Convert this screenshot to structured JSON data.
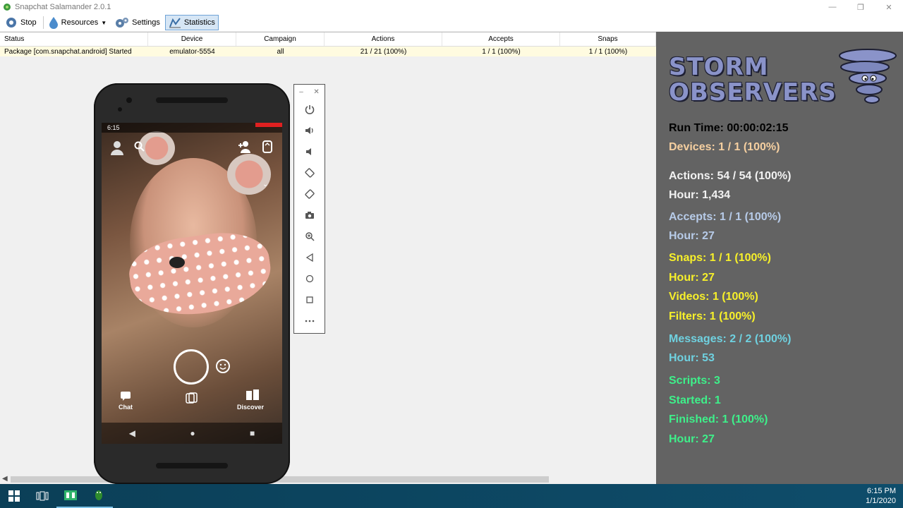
{
  "window": {
    "title": "Snapchat Salamander 2.0.1"
  },
  "toolbar": {
    "stop_label": "Stop",
    "resources_label": "Resources",
    "settings_label": "Settings",
    "statistics_label": "Statistics"
  },
  "grid": {
    "headers": [
      "Status",
      "Device",
      "Campaign",
      "Actions",
      "Accepts",
      "Snaps"
    ],
    "rows": [
      {
        "status": "Package [com.snapchat.android] Started",
        "device": "emulator-5554",
        "campaign": "all",
        "actions": "21 / 21 (100%)",
        "accepts": "1 / 1 (100%)",
        "snaps": "1 / 1 (100%)"
      }
    ]
  },
  "phone": {
    "status_time": "6:15",
    "chat_label": "Chat",
    "discover_label": "Discover"
  },
  "stats": {
    "logo_line1": "STORM",
    "logo_line2": "OBSERVERS",
    "run_time": "Run Time: 00:00:02:15",
    "devices": "Devices: 1 / 1 (100%)",
    "actions": "Actions: 54 / 54 (100%)",
    "actions_hour": "Hour: 1,434",
    "accepts": "Accepts: 1 / 1 (100%)",
    "accepts_hour": "Hour: 27",
    "snaps": "Snaps: 1 / 1 (100%)",
    "snaps_hour": "Hour: 27",
    "videos": "Videos: 1 (100%)",
    "filters": "Filters: 1 (100%)",
    "messages": "Messages: 2 / 2 (100%)",
    "messages_hour": "Hour: 53",
    "scripts": "Scripts: 3",
    "started": "Started: 1",
    "finished": "Finished: 1 (100%)",
    "scripts_hour": "Hour: 27"
  },
  "taskbar": {
    "time": "6:15 PM",
    "date": "1/1/2020"
  },
  "colors": {
    "stats_bg": "#636363",
    "yellow": "#f7f02a",
    "teal": "#6fd1e0",
    "green": "#3ef08a",
    "logo": "#8a93c9"
  }
}
